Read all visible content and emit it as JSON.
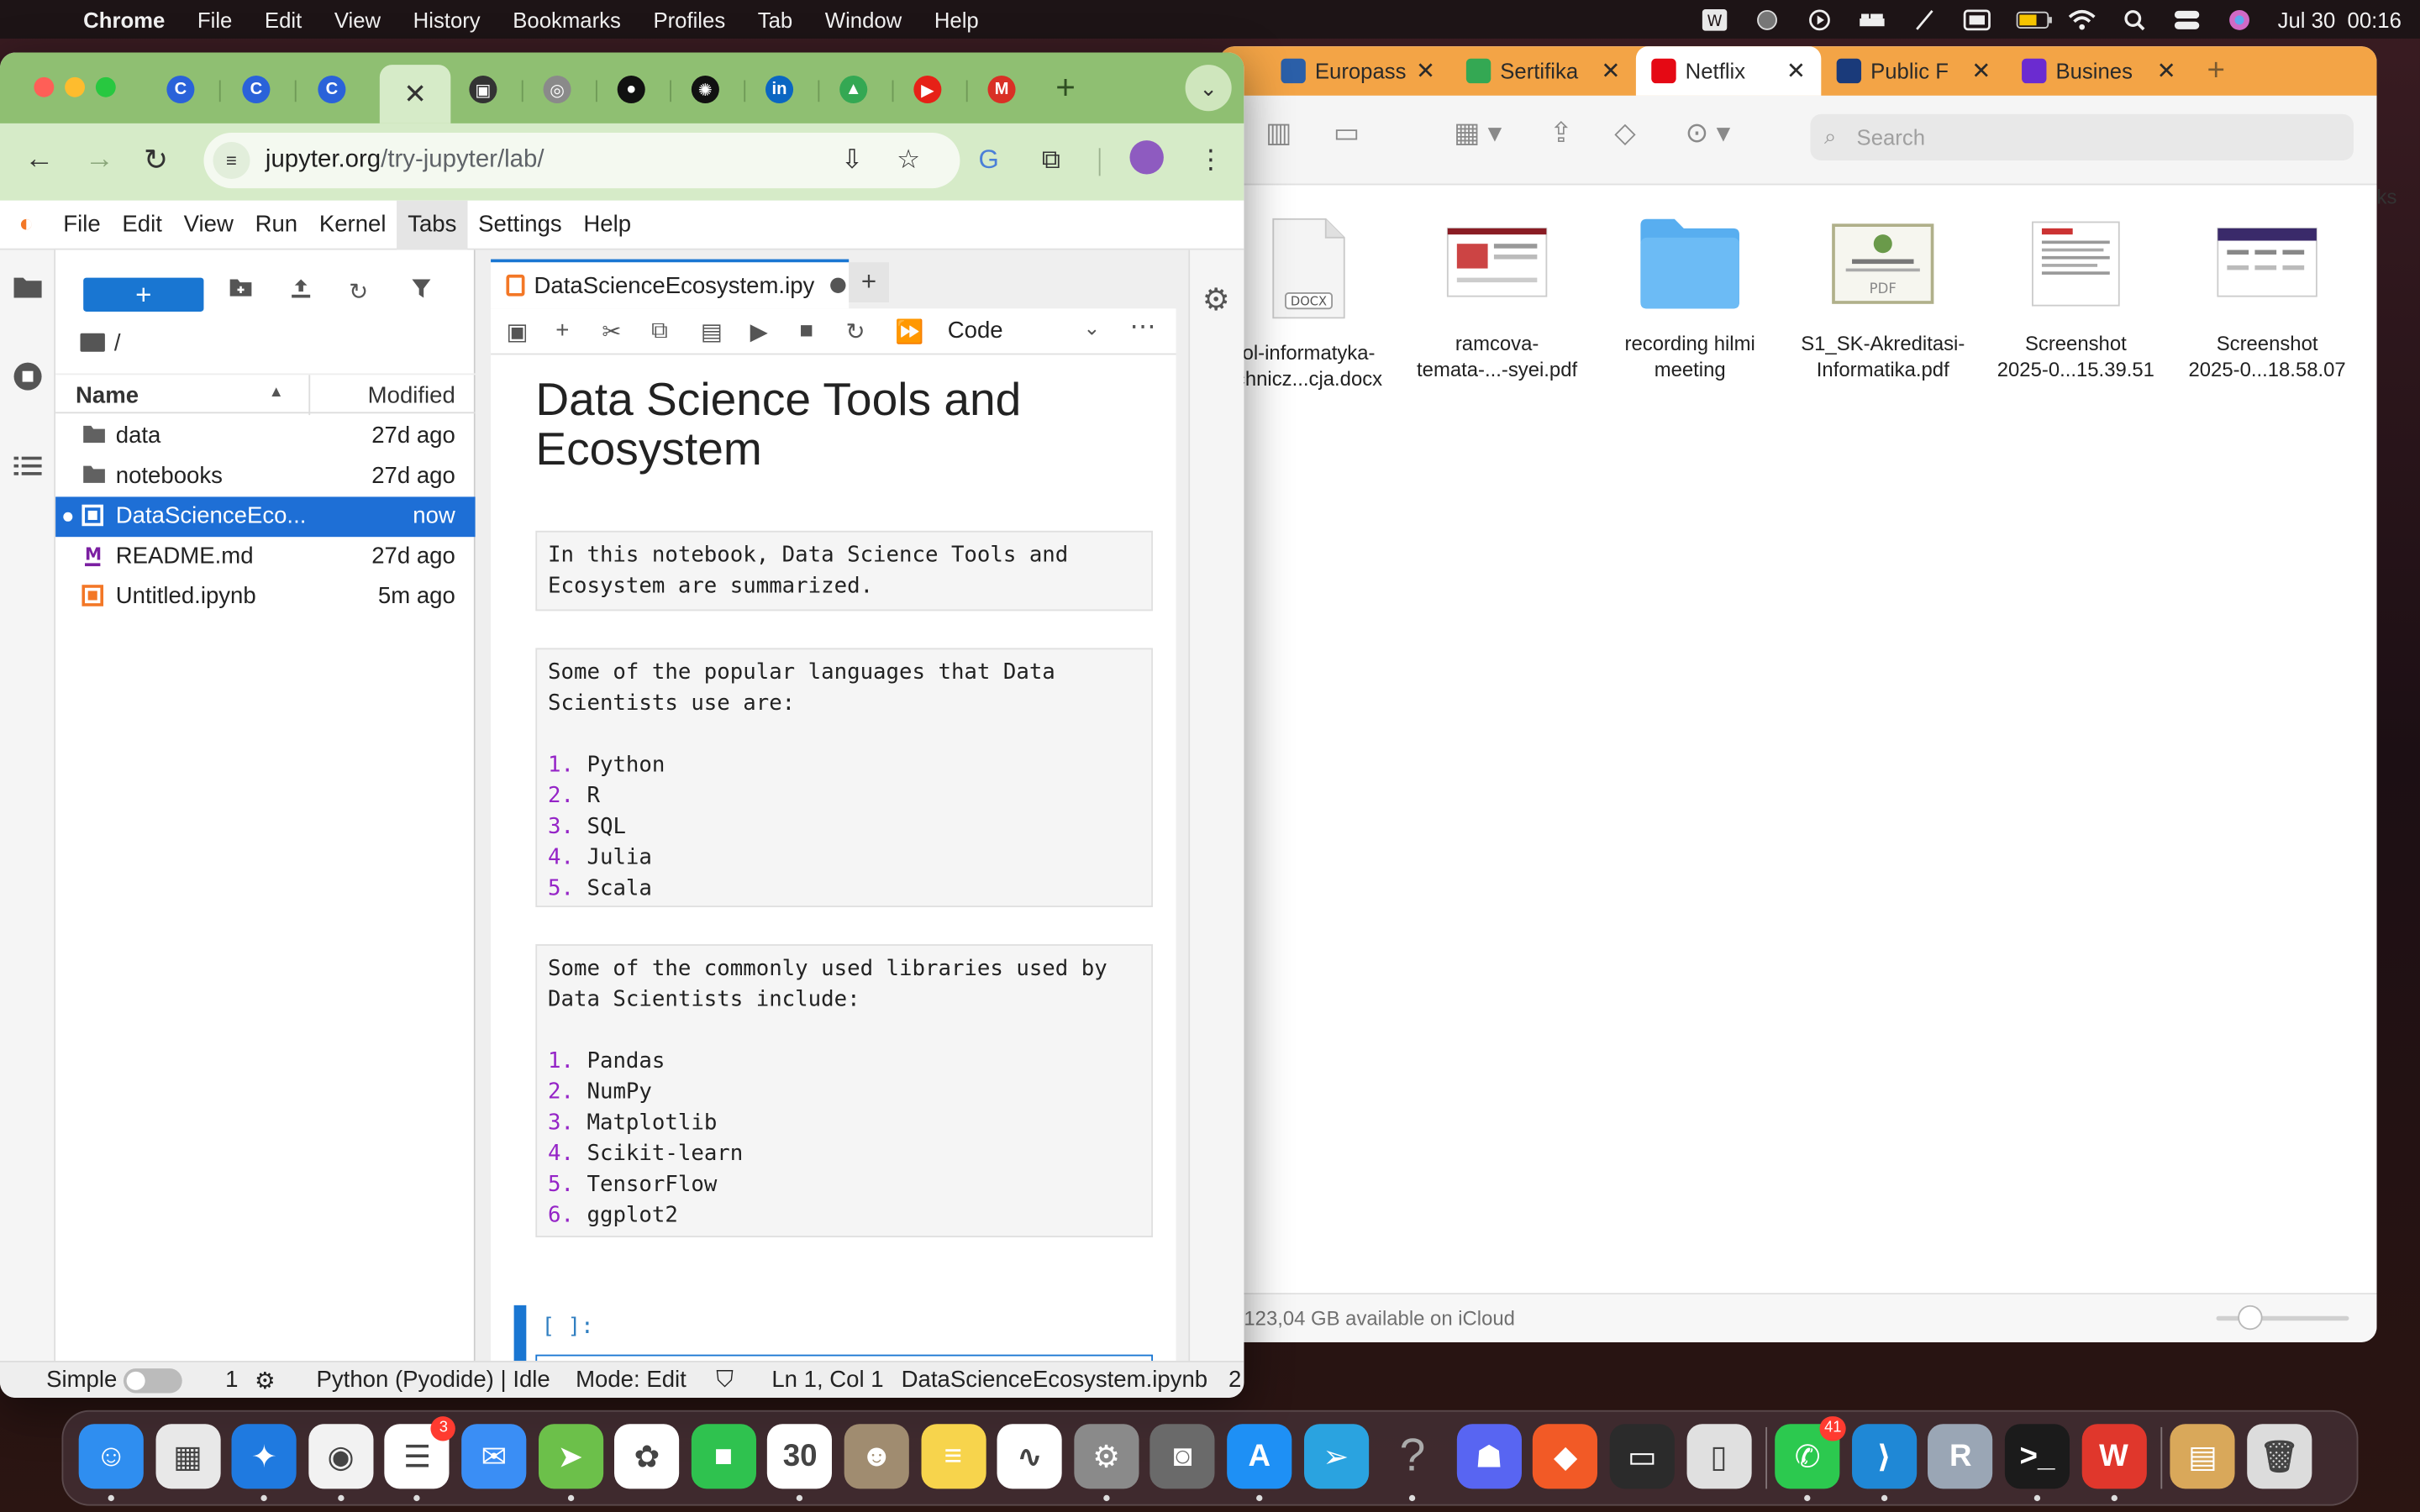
{
  "menubar": {
    "app": "Chrome",
    "items": [
      "File",
      "Edit",
      "View",
      "History",
      "Bookmarks",
      "Profiles",
      "Tab",
      "Window",
      "Help"
    ],
    "datetime": "Jul 30  00:16",
    "icons": [
      "word-icon",
      "globe-icon",
      "play-icon",
      "bed-icon",
      "slash-icon",
      "display-icon",
      "battery-icon",
      "wifi-icon",
      "search-icon",
      "control-center-icon",
      "siri-icon"
    ]
  },
  "finder": {
    "tabs": [
      {
        "label": "Europass",
        "color": "#2b5fa8"
      },
      {
        "label": "Sertifika",
        "color": "#34a853"
      },
      {
        "label": "Netflix",
        "color": "#e50914",
        "active": true
      },
      {
        "label": "Public F",
        "color": "#1a3a7a"
      },
      {
        "label": "Busines",
        "color": "#6b2bd0"
      }
    ],
    "search_placeholder": "Search",
    "files": [
      {
        "line1": "ol-informatyka-",
        "line2": "chnicz...cja.docx",
        "kind": "docx"
      },
      {
        "line1": "ramcova-",
        "line2": "temata-...-syei.pdf",
        "kind": "pdf-wide"
      },
      {
        "line1": "recording hilmi",
        "line2": "meeting",
        "kind": "folder"
      },
      {
        "line1": "S1_SK-Akreditasi-",
        "line2": "Informatika.pdf",
        "kind": "pdf-cert"
      },
      {
        "line1": "Screenshot",
        "line2": "2025-0...15.39.51",
        "kind": "shot1"
      },
      {
        "line1": "Screenshot",
        "line2": "2025-0...18.58.07",
        "kind": "shot2"
      }
    ],
    "status": "123,04 GB available on iCloud",
    "side_text": "ks"
  },
  "chrome": {
    "tab_favicons": [
      {
        "name": "c-favicon-1",
        "letter": "C",
        "color": "#2a62d9"
      },
      {
        "name": "c-favicon-2",
        "letter": "C",
        "color": "#2a62d9"
      },
      {
        "name": "c-favicon-3",
        "letter": "C",
        "color": "#2a62d9"
      },
      {
        "name": "screen-favicon",
        "letter": "▣",
        "color": "#333333"
      },
      {
        "name": "circle-favicon",
        "letter": "◎",
        "color": "#8a8a8a"
      },
      {
        "name": "github-favicon",
        "letter": "●",
        "color": "#111111"
      },
      {
        "name": "openai-favicon",
        "letter": "✺",
        "color": "#111111"
      },
      {
        "name": "linkedin-favicon",
        "letter": "in",
        "color": "#0a66c2"
      },
      {
        "name": "drive-favicon",
        "letter": "▲",
        "color": "#34a853"
      },
      {
        "name": "youtube-favicon",
        "letter": "▶",
        "color": "#e62117"
      },
      {
        "name": "gmail-favicon",
        "letter": "M",
        "color": "#d93025"
      }
    ],
    "active_tab_close": "✕",
    "url_host": "jupyter.org",
    "url_path": "/try-jupyter/lab/"
  },
  "jupyter": {
    "menu": [
      "File",
      "Edit",
      "View",
      "Run",
      "Kernel",
      "Tabs",
      "Settings",
      "Help"
    ],
    "active_menu": "Tabs",
    "new_button": "+",
    "breadcrumb": "/",
    "columns": {
      "name": "Name",
      "modified": "Modified"
    },
    "files": [
      {
        "name": "data",
        "modified": "27d ago",
        "type": "folder"
      },
      {
        "name": "notebooks",
        "modified": "27d ago",
        "type": "folder"
      },
      {
        "name": "DataScienceEco...",
        "modified": "now",
        "type": "notebook",
        "selected": true
      },
      {
        "name": "README.md",
        "modified": "27d ago",
        "type": "markdown"
      },
      {
        "name": "Untitled.ipynb",
        "modified": "5m ago",
        "type": "notebook"
      }
    ],
    "notebook_tab": "DataScienceEcosystem.ipy",
    "cell_type": "Code",
    "title": "Data Science Tools and Ecosystem",
    "intro": "In this notebook, Data Science Tools and Ecosystem are summarized.",
    "languages_intro": "Some of the popular languages that Data Scientists use are:",
    "languages": [
      "Python",
      "R",
      "SQL",
      "Julia",
      "Scala"
    ],
    "libraries_intro": "Some of the commonly used libraries used by Data Scientists include:",
    "libraries": [
      "Pandas",
      "NumPy",
      "Matplotlib",
      "Scikit-learn",
      "TensorFlow",
      "ggplot2"
    ],
    "code_prompt": "[ ]:",
    "status": {
      "simple": "Simple",
      "count": "1",
      "kernel": "Python (Pyodide) | Idle",
      "mode": "Mode: Edit",
      "position": "Ln 1, Col 1",
      "file": "DataScienceEcosystem.ipynb",
      "extra": "2"
    }
  },
  "dock": {
    "apps": [
      {
        "name": "finder-icon",
        "color": "#2f8ef0",
        "glyph": "☺"
      },
      {
        "name": "launchpad-icon",
        "color": "#e8e8e8",
        "glyph": "▦"
      },
      {
        "name": "safari-icon",
        "color": "#1f7ae0",
        "glyph": "✦"
      },
      {
        "name": "chrome-icon",
        "color": "#f2f2f2",
        "glyph": "◉"
      },
      {
        "name": "reminders-icon",
        "color": "#ffffff",
        "glyph": "☰",
        "badge": "3"
      },
      {
        "name": "mail-icon",
        "color": "#3a8ef5",
        "glyph": "✉"
      },
      {
        "name": "maps-icon",
        "color": "#6cc04a",
        "glyph": "➤"
      },
      {
        "name": "photos-icon",
        "color": "#ffffff",
        "glyph": "✿"
      },
      {
        "name": "facetime-icon",
        "color": "#2fc24f",
        "glyph": "■"
      },
      {
        "name": "calendar-icon",
        "color": "#ffffff",
        "glyph": "30"
      },
      {
        "name": "contacts-icon",
        "color": "#a08c70",
        "glyph": "☻"
      },
      {
        "name": "notes-icon",
        "color": "#f7d44c",
        "glyph": "≡"
      },
      {
        "name": "freeform-icon",
        "color": "#ffffff",
        "glyph": "∿"
      },
      {
        "name": "system-settings-icon",
        "color": "#8a8a8a",
        "glyph": "⚙"
      },
      {
        "name": "screenshot-icon",
        "color": "#6a6a6a",
        "glyph": "◙"
      },
      {
        "name": "app-store-icon",
        "color": "#1e90f5",
        "glyph": "A"
      },
      {
        "name": "telegram-icon",
        "color": "#2aa3e0",
        "glyph": "➢"
      },
      {
        "name": "help-icon",
        "color": "transparent",
        "glyph": "?"
      },
      {
        "name": "discord-icon",
        "color": "#5865f2",
        "glyph": "☗"
      },
      {
        "name": "brave-icon",
        "color": "#f25a26",
        "glyph": "◆"
      },
      {
        "name": "terminal-exec-icon",
        "color": "#2b2b2b",
        "glyph": "▭"
      },
      {
        "name": "iphone-mirroring-icon",
        "color": "#e0e0e0",
        "glyph": "▯"
      },
      {
        "name": "whatsapp-icon",
        "color": "#2cc94f",
        "glyph": "✆",
        "badge": "41"
      },
      {
        "name": "vscode-icon",
        "color": "#1f88d6",
        "glyph": "⟩"
      },
      {
        "name": "r-icon",
        "color": "#9aa6b5",
        "glyph": "R"
      },
      {
        "name": "terminal-icon",
        "color": "#1b1b1b",
        "glyph": ">_"
      },
      {
        "name": "wps-icon",
        "color": "#e0372c",
        "glyph": "W"
      },
      {
        "name": "archive-icon",
        "color": "#d9a85a",
        "glyph": "▤"
      },
      {
        "name": "trash-icon",
        "color": "#dcdcdc",
        "glyph": "🗑"
      }
    ]
  }
}
